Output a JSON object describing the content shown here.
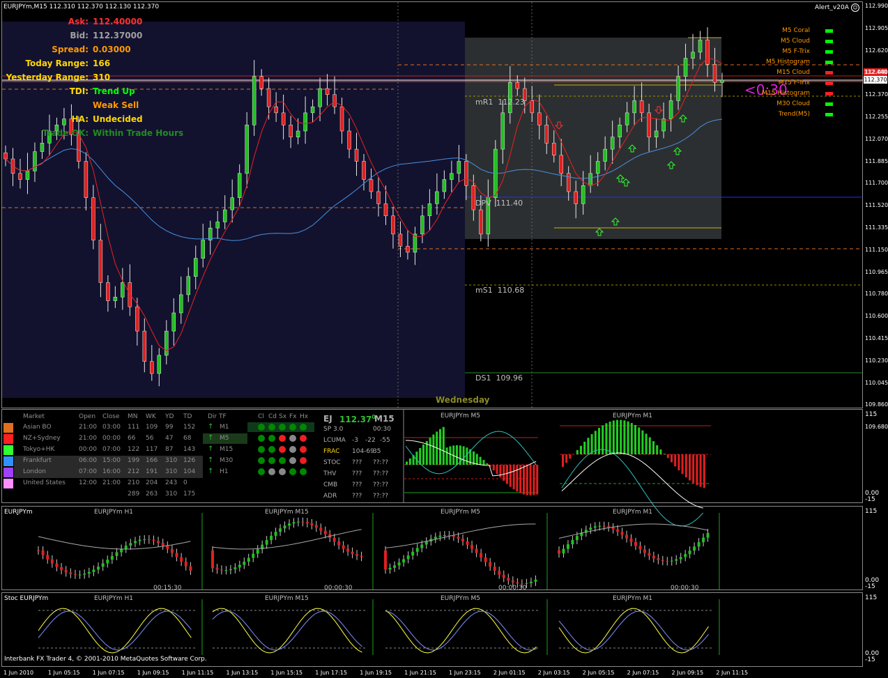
{
  "main": {
    "title": "EURJPYm,M15  112.310 112.370 112.130 112.370",
    "alert_name": "Alert_v20A",
    "info": [
      {
        "label": "Ask:",
        "value": "112.40000",
        "label_color": "#ff3030",
        "value_color": "#ff3030"
      },
      {
        "label": "Bid:",
        "value": "112.37000",
        "label_color": "#a0a0a0",
        "value_color": "#a0a0a0"
      },
      {
        "label": "Spread:",
        "value": "0.03000",
        "label_color": "#ff9900",
        "value_color": "#ff9900"
      },
      {
        "label": "Today Range:",
        "value": "166",
        "label_color": "#ffd700",
        "value_color": "#ffd700"
      },
      {
        "label": "Yesterday Range:",
        "value": "310",
        "label_color": "#ffd700",
        "value_color": "#ffd700"
      },
      {
        "label": "TDI:",
        "value": "Trend Up",
        "label_color": "#ffd700",
        "value_color": "#00ff00"
      },
      {
        "label": "",
        "value": "Weak Sell",
        "label_color": "#ffd700",
        "value_color": "#ff9900"
      },
      {
        "label": "HA:",
        "value": "Undecided",
        "label_color": "#ffd700",
        "value_color": "#ffd700"
      },
      {
        "label": "Trade OK:",
        "value": "Within Trade Hours",
        "label_color": "#228b22",
        "value_color": "#228b22"
      }
    ],
    "pivots": [
      {
        "label": "mR1",
        "value": "112.23"
      },
      {
        "label": "DPV",
        "value": "111.40"
      },
      {
        "label": "mS1",
        "value": "110.68"
      },
      {
        "label": "DS1",
        "value": "109.96"
      }
    ],
    "day_label": "Wednesday",
    "countdown": "<0:30",
    "alerts": [
      {
        "label": "M5 Coral",
        "status": "#00ff00"
      },
      {
        "label": "M5 Cloud",
        "status": "#00ff00"
      },
      {
        "label": "M5 F-Trix",
        "status": "#00ff00"
      },
      {
        "label": "M5 Histogram",
        "status": "#00ff00"
      },
      {
        "label": "M15 Cloud",
        "status": "#ff2020"
      },
      {
        "label": "M15 F-Trix",
        "status": "#ff2020"
      },
      {
        "label": "M15 Histogram",
        "status": "#ff2020"
      },
      {
        "label": "M30 Cloud",
        "status": "#00ff00"
      },
      {
        "label": "Trend(M5)",
        "status": "#00ff00"
      }
    ],
    "price_axis": [
      "112.990",
      "112.905",
      "112.620",
      "112.440",
      "112.370",
      "112.255",
      "112.070",
      "111.885",
      "111.700",
      "111.520",
      "111.335",
      "111.150",
      "110.965",
      "110.780",
      "110.600",
      "110.415",
      "110.230",
      "110.045",
      "109.860",
      "109.680"
    ]
  },
  "markets": {
    "headers": [
      "Market",
      "Open",
      "Close",
      "MN",
      "WK",
      "YD",
      "TD"
    ],
    "rows": [
      {
        "color": "#e07020",
        "name": "Asian BO",
        "cells": [
          "21:00",
          "03:00",
          "111",
          "109",
          "99",
          "152"
        ]
      },
      {
        "color": "#ff2020",
        "name": "NZ+Sydney",
        "cells": [
          "21:00",
          "00:00",
          "66",
          "56",
          "47",
          "68"
        ]
      },
      {
        "color": "#30ff30",
        "name": "Tokyo+HK",
        "cells": [
          "00:00",
          "07:00",
          "122",
          "117",
          "87",
          "143"
        ]
      },
      {
        "color": "#3090ff",
        "name": "Frankfurt",
        "cells": [
          "06:00",
          "15:00",
          "199",
          "166",
          "310",
          "126"
        ]
      },
      {
        "color": "#a040ff",
        "name": "London",
        "cells": [
          "07:00",
          "16:00",
          "212",
          "191",
          "310",
          "104"
        ]
      },
      {
        "color": "#ff90ff",
        "name": "United States",
        "cells": [
          "12:00",
          "21:00",
          "210",
          "204",
          "243",
          "0"
        ]
      }
    ],
    "totals": [
      "289",
      "263",
      "310",
      "175"
    ],
    "tf_headers": [
      "Dir",
      "TF"
    ],
    "tf_rows": [
      {
        "dir": "↑",
        "tf": "M1",
        "dots": [
          "#008800",
          "#008800",
          "#008800",
          "#008800",
          "#008800"
        ]
      },
      {
        "dir": "↑",
        "tf": "M5",
        "dots": [
          "#008800",
          "#008800",
          "#ee2020",
          "#888888",
          "#ee2020"
        ]
      },
      {
        "dir": "↑",
        "tf": "M15",
        "dots": [
          "#008800",
          "#008800",
          "#ee2020",
          "#888888",
          "#ee2020"
        ]
      },
      {
        "dir": "↑",
        "tf": "M30",
        "dots": [
          "#008800",
          "#008800",
          "#008800",
          "#888888",
          "#ee2020"
        ]
      },
      {
        "dir": "↑",
        "tf": "H1",
        "dots": [
          "#008800",
          "#888888",
          "#888888",
          "#008800",
          "#008800"
        ]
      }
    ],
    "dot_headers": [
      "Cl",
      "Cd",
      "Sx",
      "Fx",
      "Hx"
    ]
  },
  "ej": {
    "symbol": "EJ",
    "price": "112.37",
    "sup": "0",
    "tf": "M15",
    "sp": "SP 3.0",
    "time": "00:30",
    "rows": [
      {
        "label": "LCUMA",
        "vals": [
          "-3",
          "-22",
          "-55"
        ]
      },
      {
        "label": "FRAC",
        "vals": [
          "104-69",
          "35"
        ]
      },
      {
        "label": "STOC",
        "vals": [
          "???",
          "??:??"
        ]
      },
      {
        "label": "THV",
        "vals": [
          "???",
          "??:??"
        ]
      },
      {
        "label": "CMB",
        "vals": [
          "???",
          "??:??"
        ]
      },
      {
        "label": "ADR",
        "vals": [
          "???",
          "??:??"
        ]
      }
    ]
  },
  "subcharts": {
    "m5_title": "EURJPYm M5",
    "m1_title": "EURJPYm M1",
    "axis_top": "115",
    "axis_mid": "0.00",
    "axis_bot": "-15"
  },
  "mini": {
    "label": "EURJPYm",
    "titles": [
      "EURJPYm H1",
      "EURJPYm M15",
      "EURJPYm M5",
      "EURJPYm M1"
    ],
    "times": [
      "00:15:30",
      "00:00:30",
      "00:00:30",
      "00:00:30"
    ]
  },
  "stoc": {
    "label": "Stoc EURJPYm",
    "titles": [
      "EURJPYm H1",
      "EURJPYm M15",
      "EURJPYm M5",
      "EURJPYm M1"
    ]
  },
  "footer": "Interbank FX Trader 4, © 2001-2010 MetaQuotes Software Corp.",
  "time_axis": [
    "1 Jun 2010",
    "1 Jun 05:15",
    "1 Jun 07:15",
    "1 Jun 09:15",
    "1 Jun 11:15",
    "1 Jun 13:15",
    "1 Jun 15:15",
    "1 Jun 17:15",
    "1 Jun 19:15",
    "1 Jun 21:15",
    "1 Jun 23:15",
    "2 Jun 01:15",
    "2 Jun 03:15",
    "2 Jun 05:15",
    "2 Jun 07:15",
    "2 Jun 09:15",
    "2 Jun 11:15"
  ],
  "chart_data": {
    "type": "candlestick",
    "title": "EURJPYm,M15",
    "ylim": [
      109.68,
      112.99
    ],
    "closes": [
      111.72,
      111.6,
      111.55,
      111.62,
      111.78,
      111.85,
      111.95,
      112.0,
      112.05,
      111.92,
      111.7,
      111.4,
      111.05,
      110.7,
      110.55,
      110.58,
      110.7,
      110.5,
      110.3,
      110.05,
      109.95,
      110.1,
      110.3,
      110.45,
      110.6,
      110.75,
      110.9,
      111.05,
      111.15,
      111.2,
      111.3,
      111.4,
      111.6,
      112.0,
      112.4,
      112.3,
      112.15,
      112.1,
      112.0,
      111.9,
      111.95,
      112.1,
      112.15,
      112.3,
      112.25,
      112.15,
      111.95,
      111.8,
      111.7,
      111.55,
      111.45,
      111.35,
      111.25,
      111.1,
      111.0,
      110.95,
      111.1,
      111.25,
      111.35,
      111.45,
      111.55,
      111.6,
      111.7,
      111.5,
      111.3,
      111.1,
      111.4,
      111.8,
      112.1,
      112.35,
      112.3,
      112.2,
      112.1,
      112.0,
      111.85,
      111.75,
      111.6,
      111.45,
      111.35,
      111.5,
      111.6,
      111.7,
      111.8,
      111.9,
      112.0,
      112.1,
      112.2,
      112.1,
      111.9,
      111.95,
      112.05,
      112.2,
      112.4,
      112.55,
      112.6,
      112.7,
      112.5,
      112.35,
      112.37
    ]
  }
}
